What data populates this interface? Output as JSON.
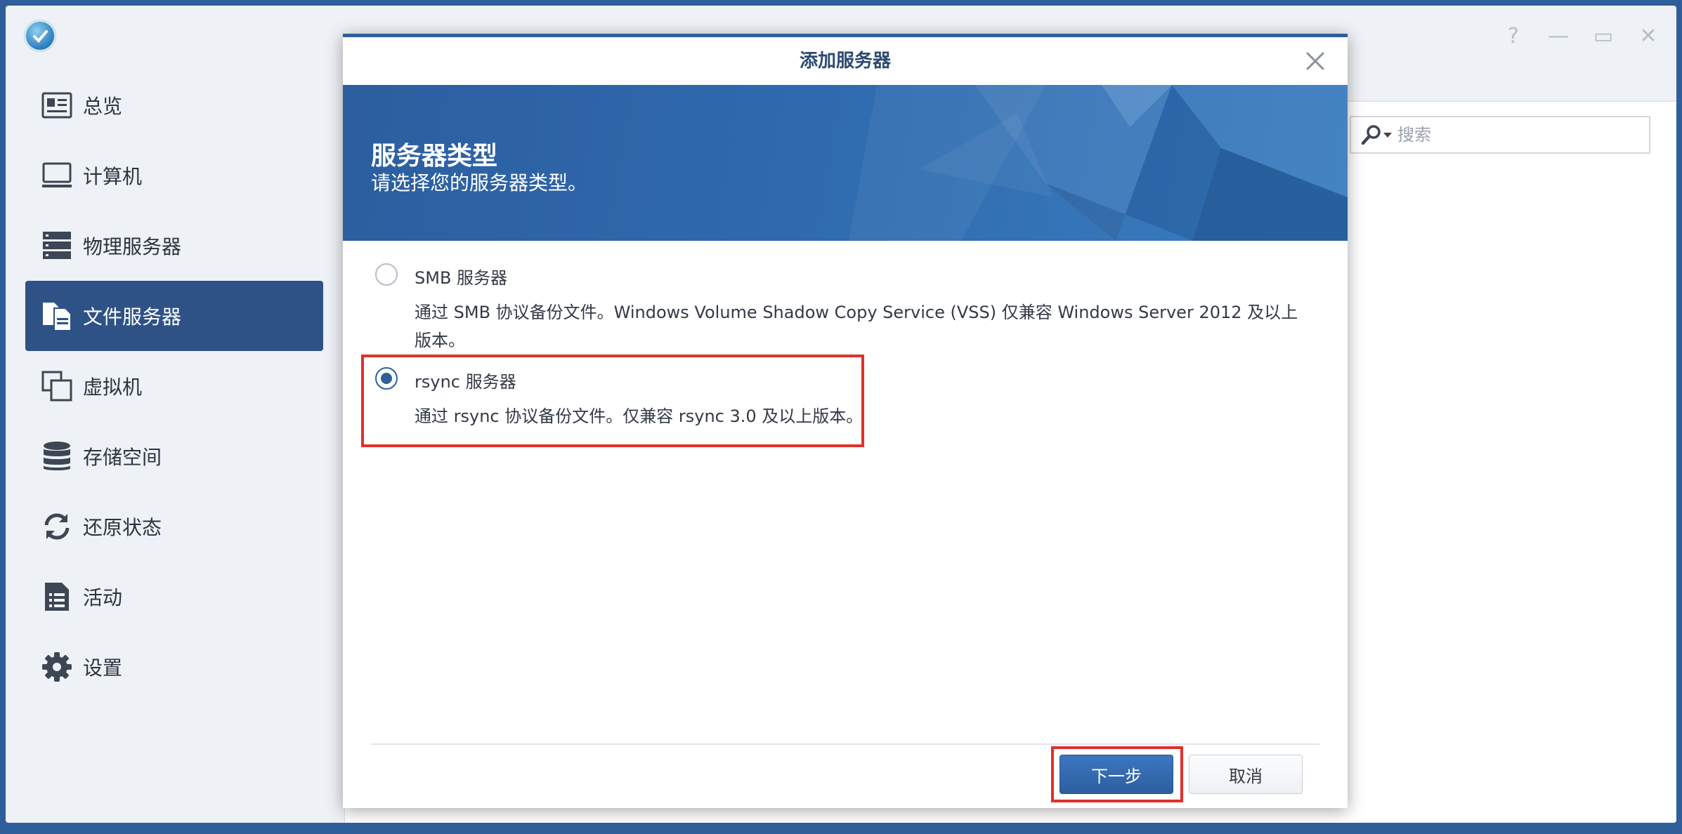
{
  "sidebar": {
    "items": [
      {
        "label": "总览",
        "icon": "overview-card-icon",
        "active": false
      },
      {
        "label": "计算机",
        "icon": "monitor-icon",
        "active": false
      },
      {
        "label": "物理服务器",
        "icon": "server-rack-icon",
        "active": false
      },
      {
        "label": "文件服务器",
        "icon": "file-server-icon",
        "active": true
      },
      {
        "label": "虚拟机",
        "icon": "virtual-machine-icon",
        "active": false
      },
      {
        "label": "存储空间",
        "icon": "storage-database-icon",
        "active": false
      },
      {
        "label": "还原状态",
        "icon": "restore-arrows-icon",
        "active": false
      },
      {
        "label": "活动",
        "icon": "activity-list-icon",
        "active": false
      },
      {
        "label": "设置",
        "icon": "gear-icon",
        "active": false
      }
    ]
  },
  "window_controls": {
    "help": "?",
    "minimize": "—",
    "maximize": "▭",
    "close": "✕"
  },
  "search": {
    "placeholder": "搜索"
  },
  "dialog": {
    "title": "添加服务器",
    "banner_title": "服务器类型",
    "banner_subtitle": "请选择您的服务器类型。",
    "options": [
      {
        "label": "SMB 服务器",
        "checked": false,
        "desc_line1": "通过 SMB 协议备份文件。Windows Volume Shadow Copy Service (VSS) 仅兼容 Windows Server 2012 及以上",
        "desc_line2": "版本。"
      },
      {
        "label": "rsync 服务器",
        "checked": true,
        "desc_line1": "通过 rsync 协议备份文件。仅兼容 rsync 3.0 及以上版本。"
      }
    ],
    "next_label": "下一步",
    "cancel_label": "取消"
  },
  "colors": {
    "accent": "#2f5f9a",
    "active_nav": "#2e5286",
    "highlight": "#e0302a",
    "banner": "#2f6aae"
  }
}
